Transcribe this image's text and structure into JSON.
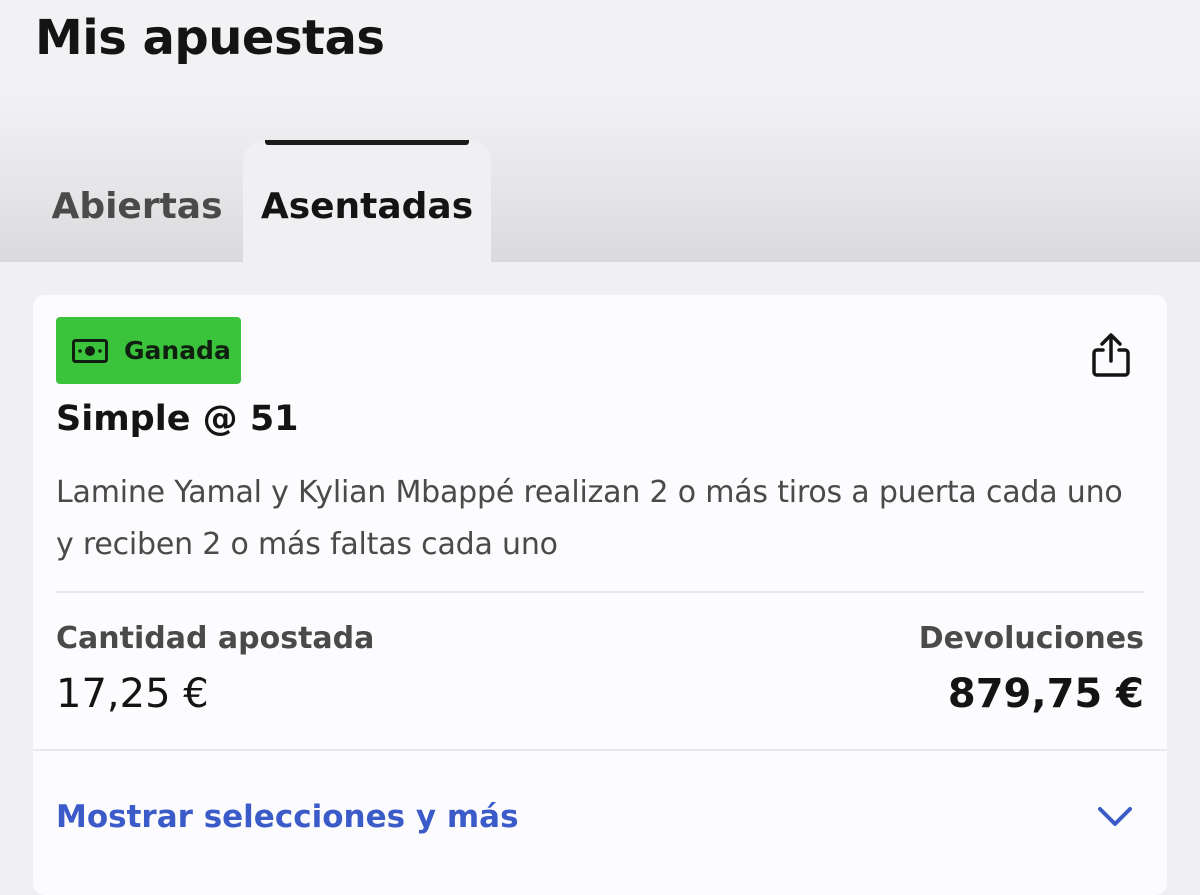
{
  "header": {
    "title": "Mis apuestas"
  },
  "tabs": [
    {
      "label": "Abiertas",
      "active": false
    },
    {
      "label": "Asentadas",
      "active": true
    }
  ],
  "bet": {
    "status": "Ganada",
    "status_color": "#3cc33c",
    "status_icon": "banknote-icon",
    "share_icon": "share-icon",
    "title": "Simple @ 51",
    "description": "Lamine Yamal y Kylian Mbappé realizan 2 o más tiros a puerta cada uno y reciben 2 o más faltas cada uno",
    "stake_label": "Cantidad apostada",
    "stake_value": "17,25 €",
    "returns_label": "Devoluciones",
    "returns_value": "879,75 €",
    "show_more_label": "Mostrar selecciones y más",
    "show_more_icon": "chevron-down-icon",
    "link_color": "#3b5bc9"
  }
}
